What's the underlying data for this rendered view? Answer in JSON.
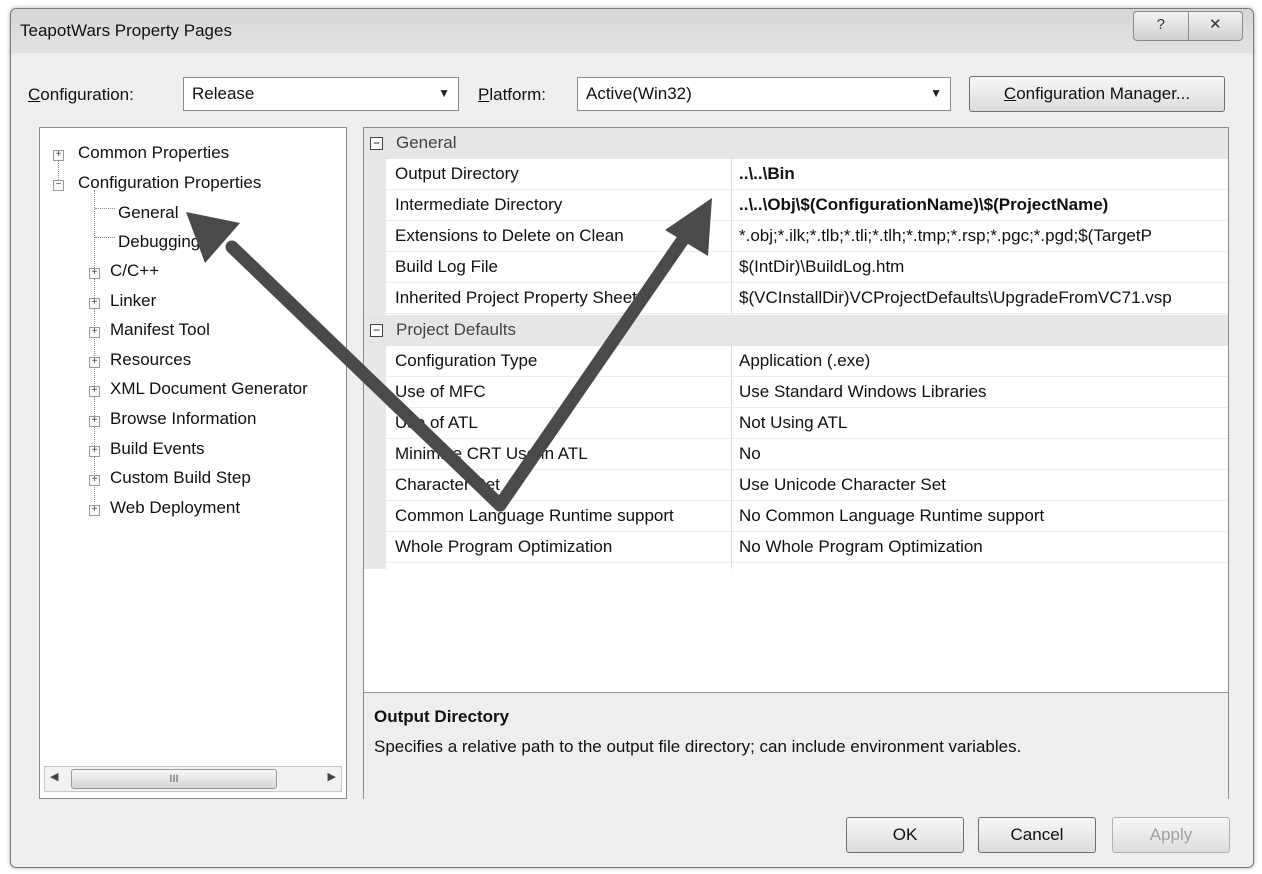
{
  "window": {
    "title": "TeapotWars Property Pages",
    "help_glyph": "?",
    "close_glyph": "✕"
  },
  "toolbar": {
    "configuration_label_first": "C",
    "configuration_label_rest": "onfiguration:",
    "configuration_value": "Release",
    "platform_label_first": "P",
    "platform_label_rest": "latform:",
    "platform_value": "Active(Win32)",
    "config_manager_first": "C",
    "config_manager_rest": "onfiguration Manager..."
  },
  "tree": {
    "items": [
      {
        "label": "Common Properties"
      },
      {
        "label": "Configuration Properties"
      },
      {
        "label": "General"
      },
      {
        "label": "Debugging"
      },
      {
        "label": "C/C++"
      },
      {
        "label": "Linker"
      },
      {
        "label": "Manifest Tool"
      },
      {
        "label": "Resources"
      },
      {
        "label": "XML Document Generator"
      },
      {
        "label": "Browse Information"
      },
      {
        "label": "Build Events"
      },
      {
        "label": "Custom Build Step"
      },
      {
        "label": "Web Deployment"
      }
    ],
    "scroll_thumb_glyph": "III"
  },
  "grid": {
    "sections": [
      {
        "label": "General",
        "rows": [
          {
            "name": "Output Directory",
            "value": "..\\..\\Bin",
            "bold": true
          },
          {
            "name": "Intermediate Directory",
            "value": "..\\..\\Obj\\$(ConfigurationName)\\$(ProjectName)",
            "bold": true
          },
          {
            "name": "Extensions to Delete on Clean",
            "value": "*.obj;*.ilk;*.tlb;*.tli;*.tlh;*.tmp;*.rsp;*.pgc;*.pgd;$(TargetP",
            "bold": false
          },
          {
            "name": "Build Log File",
            "value": "$(IntDir)\\BuildLog.htm",
            "bold": false
          },
          {
            "name": "Inherited Project Property Sheets",
            "value": "$(VCInstallDir)VCProjectDefaults\\UpgradeFromVC71.vsp",
            "bold": false
          }
        ]
      },
      {
        "label": "Project Defaults",
        "rows": [
          {
            "name": "Configuration Type",
            "value": "Application (.exe)",
            "bold": false
          },
          {
            "name": "Use of MFC",
            "value": "Use Standard Windows Libraries",
            "bold": false
          },
          {
            "name": "Use of ATL",
            "value": "Not Using ATL",
            "bold": false
          },
          {
            "name": "Minimize CRT Use in ATL",
            "value": "No",
            "bold": false
          },
          {
            "name": "Character Set",
            "value": "Use Unicode Character Set",
            "bold": false
          },
          {
            "name": "Common Language Runtime support",
            "value": "No Common Language Runtime support",
            "bold": false
          },
          {
            "name": "Whole Program Optimization",
            "value": "No Whole Program Optimization",
            "bold": false
          }
        ]
      }
    ]
  },
  "description": {
    "title": "Output Directory",
    "text": "Specifies a relative path to the output file directory; can include environment variables."
  },
  "buttons": {
    "ok": "OK",
    "cancel": "Cancel",
    "apply": "Apply"
  }
}
